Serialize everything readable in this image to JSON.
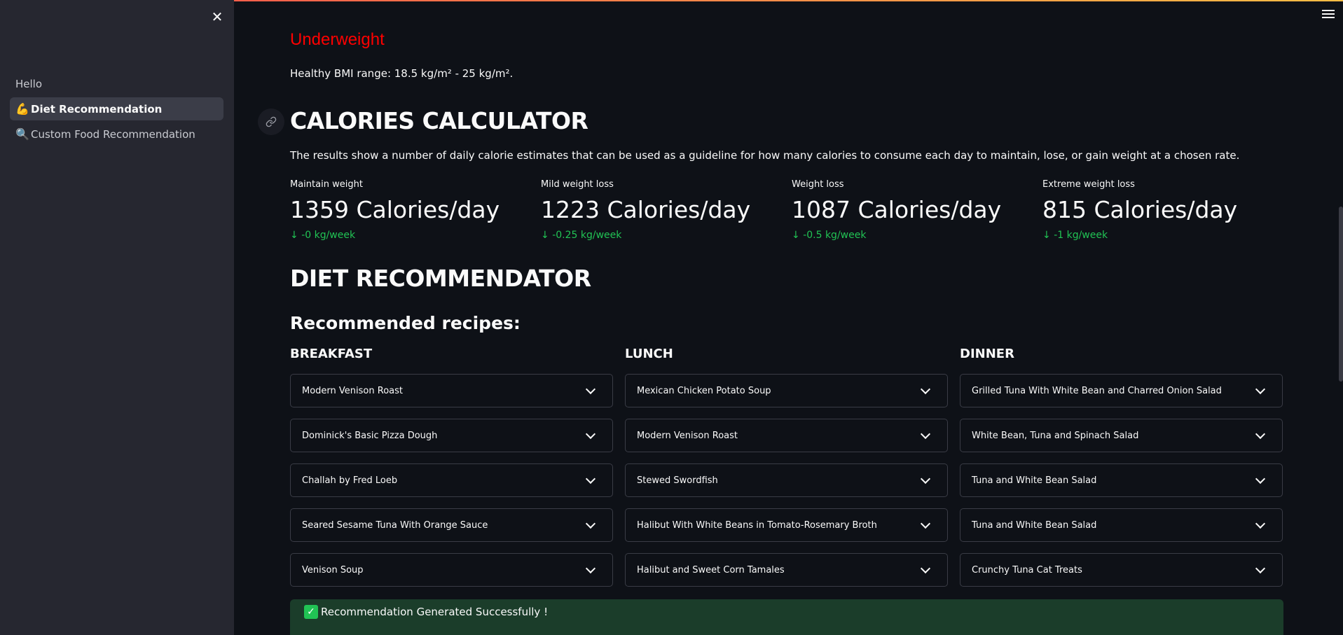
{
  "sidebar": {
    "close_label": "✕",
    "items": [
      {
        "label": "Hello",
        "icon": "",
        "active": false
      },
      {
        "label": "Diet Recommendation",
        "icon": "💪",
        "active": true
      },
      {
        "label": "Custom Food Recommendation",
        "icon": "🔍",
        "active": false
      }
    ]
  },
  "bmi": {
    "status": "Underweight",
    "status_color": "#ff0000",
    "range_text": "Healthy BMI range: 18.5 kg/m² - 25 kg/m²."
  },
  "calculator": {
    "title": "CALORIES CALCULATOR",
    "description": "The results show a number of daily calorie estimates that can be used as a guideline for how many calories to consume each day to maintain, lose, or gain weight at a chosen rate.",
    "metrics": [
      {
        "label": "Maintain weight",
        "value": "1359 Calories/day",
        "delta": "-0 kg/week"
      },
      {
        "label": "Mild weight loss",
        "value": "1223 Calories/day",
        "delta": "-0.25 kg/week"
      },
      {
        "label": "Weight loss",
        "value": "1087 Calories/day",
        "delta": "-0.5 kg/week"
      },
      {
        "label": "Extreme weight loss",
        "value": "815 Calories/day",
        "delta": "-1 kg/week"
      }
    ],
    "delta_color": "#21c354"
  },
  "recommender": {
    "title": "DIET RECOMMENDATOR",
    "subtitle": "Recommended recipes:",
    "columns": [
      {
        "title": "BREAKFAST",
        "recipes": [
          "Modern Venison Roast",
          "Dominick's Basic Pizza Dough",
          "Challah by Fred Loeb",
          "Seared Sesame Tuna With Orange Sauce",
          "Venison Soup"
        ]
      },
      {
        "title": "LUNCH",
        "recipes": [
          "Mexican Chicken Potato Soup",
          "Modern Venison Roast",
          "Stewed Swordfish",
          "Halibut With White Beans in Tomato-Rosemary Broth",
          "Halibut and Sweet Corn Tamales"
        ]
      },
      {
        "title": "DINNER",
        "recipes": [
          "Grilled Tuna With White Bean and Charred Onion Salad",
          "White Bean, Tuna and Spinach Salad",
          "Tuna and White Bean Salad",
          "Tuna and White Bean Salad",
          "Crunchy Tuna Cat Treats"
        ]
      }
    ]
  },
  "success": {
    "icon": "✓",
    "message": "Recommendation Generated Successfully !"
  },
  "icons": {
    "close": "close-icon",
    "menu": "hamburger-menu-icon",
    "link": "link-icon",
    "arrow": "arrow-down-icon",
    "chevron": "chevron-down-icon",
    "check": "check-icon"
  }
}
